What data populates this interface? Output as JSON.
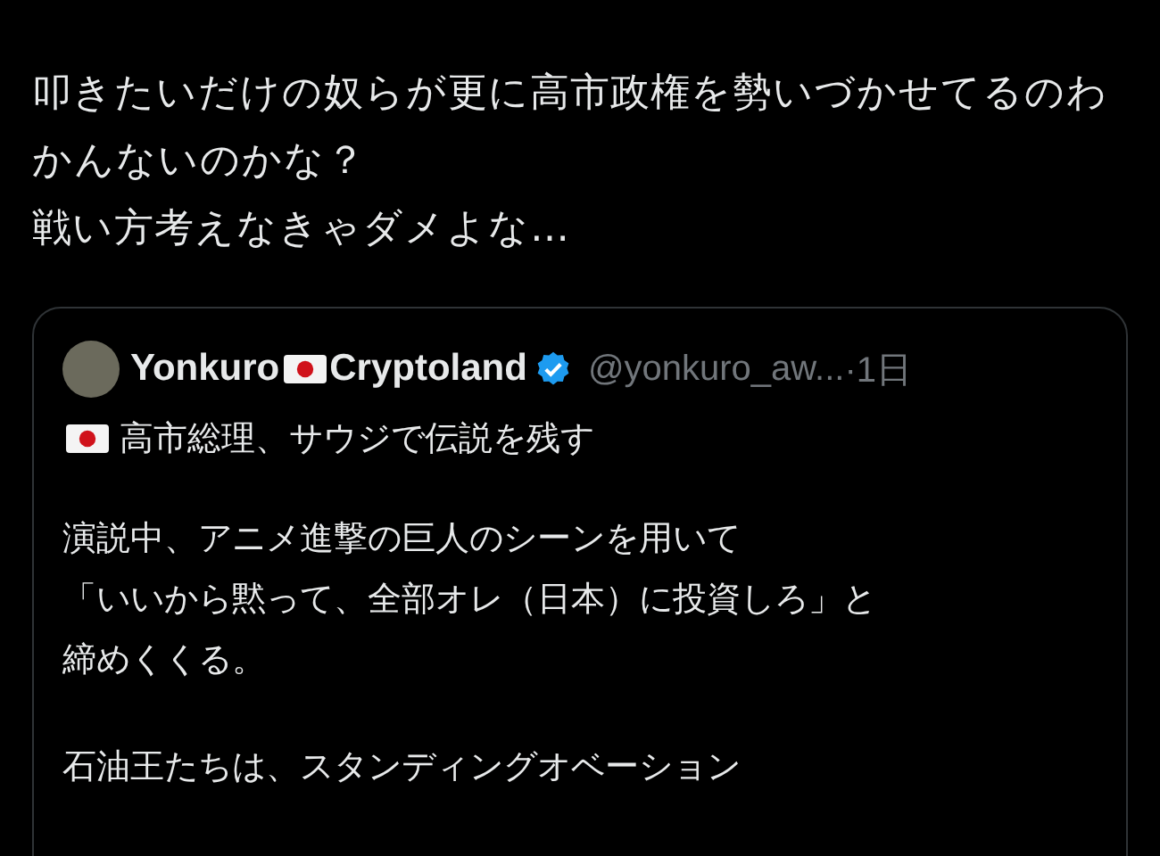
{
  "post": {
    "lines": [
      "叩きたいだけの奴らが更に高市政権を勢いづかせてるのわかんないのかな？",
      "戦い方考えなきゃダメよな…"
    ]
  },
  "quote": {
    "name_parts": [
      "Yonkuro",
      "Cryptoland"
    ],
    "verified": true,
    "handle": "@yonkuro_aw...",
    "time": "·1日",
    "headline": "高市総理、サウジで伝説を残す",
    "paragraphs": [
      [
        "演説中、アニメ進撃の巨人のシーンを用いて",
        "「いいから黙って、全部オレ（日本）に投資しろ」と",
        "締めくくる。"
      ],
      [
        "石油王たちは、スタンディングオベーション"
      ]
    ]
  }
}
